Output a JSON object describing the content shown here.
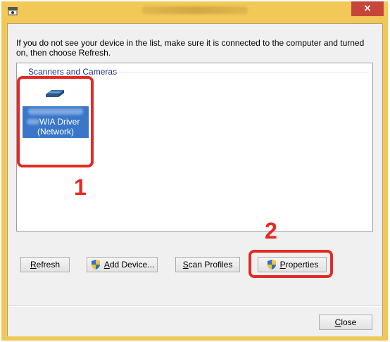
{
  "window": {
    "title": "",
    "close_glyph": "×",
    "app_icon": "scanner-app-icon"
  },
  "instruction": "If you do not see your device in the list, make sure it is connected to the computer and turned on, then choose Refresh.",
  "device_list": {
    "group_header": "Scanners and Cameras",
    "devices": [
      {
        "icon": "flatbed-scanner-icon",
        "name_line1": "WIA Driver",
        "name_line2": "(Network)",
        "selected": true
      }
    ]
  },
  "callouts": {
    "first": "1",
    "second": "2"
  },
  "buttons": {
    "refresh": {
      "label": "Refresh",
      "access_key": "R"
    },
    "add_device": {
      "label": "Add Device...",
      "access_key": "A",
      "icon": "uac-shield-icon"
    },
    "scan_profiles": {
      "label": "Scan Profiles",
      "access_key": "S"
    },
    "properties": {
      "label": "Properties",
      "access_key": "P",
      "icon": "uac-shield-icon"
    },
    "close": {
      "label": "Close",
      "access_key": "C"
    }
  },
  "colors": {
    "title_bar": "#f2c957",
    "close_button": "#c7463a",
    "selection": "#3a77c9",
    "callout_red": "#e52a24",
    "group_header": "#1e3287"
  }
}
